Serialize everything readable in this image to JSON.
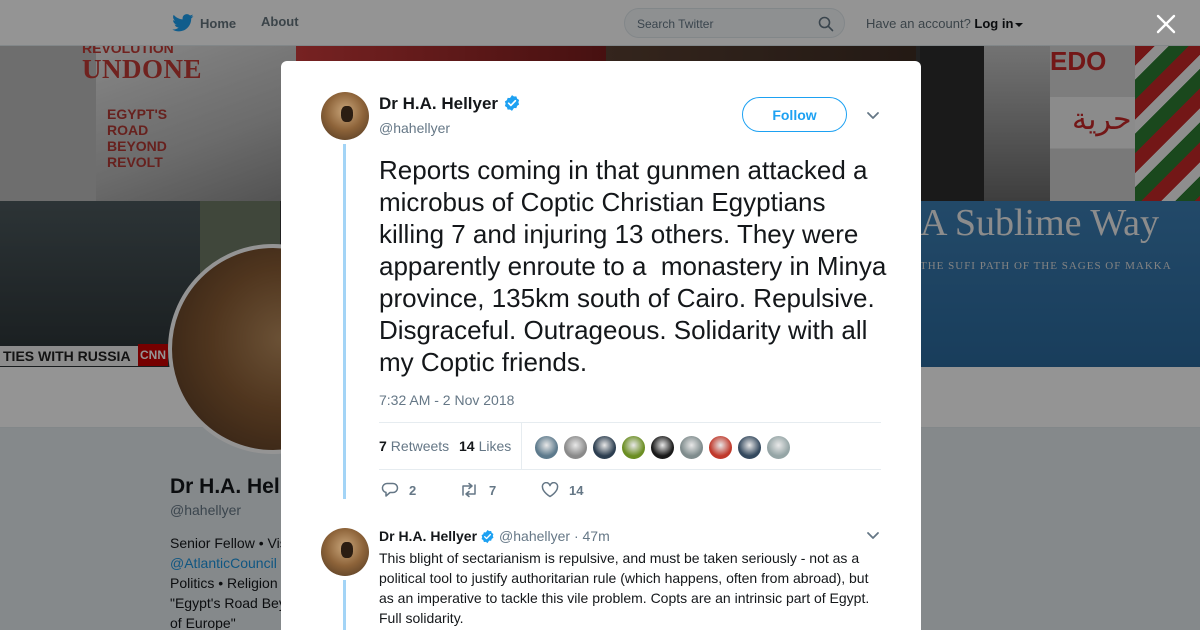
{
  "nav": {
    "home_label": "Home",
    "about_label": "About",
    "search_placeholder": "Search Twitter",
    "account_prompt": "Have an account?",
    "login_label": "Log in"
  },
  "banner": {
    "revolution_text": "REVOLUTION",
    "undone_text": "UNDONE",
    "egypt_road_text": "EGYPT'S ROAD BEYOND REVOLT",
    "cnn_strip_text": "TIES WITH RUSSIA",
    "cnn_logo_text": "CNN",
    "sublime_text": "A Sublime Way",
    "sufi_text": "THE SUFI PATH OF THE SAGES OF MAKKA",
    "arabic_text": "حرية",
    "edo_text": "EDO"
  },
  "profile": {
    "name": "Dr H.A. Hel",
    "handle": "@hahellyer",
    "bio_line1": "Senior Fellow • Vis",
    "bio_link": "@AtlanticCouncil",
    "bio_line3": "Politics • Religion",
    "bio_line4": "\"Egypt's Road Bey",
    "bio_line5": "of Europe\""
  },
  "tweet": {
    "author_name": "Dr H.A. Hellyer",
    "author_handle": "@hahellyer",
    "follow_label": "Follow",
    "text": "Reports coming in that gunmen attacked a microbus of Coptic Christian Egyptians killing 7 and injuring 13 others. They were apparently enroute to a  monastery in Minya province, 135km south of Cairo. Repulsive. Disgraceful. Outrageous. Solidarity with all my Coptic friends.",
    "timestamp": "7:32 AM - 2 Nov 2018",
    "retweets_count": "7",
    "retweets_label": "Retweets",
    "likes_count": "14",
    "likes_label": "Likes",
    "reply_count": "2",
    "retweet_action_count": "7",
    "like_action_count": "14",
    "liker_colors": [
      "#5d7a8c",
      "#8a8a8a",
      "#2c3e50",
      "#6b8e23",
      "#1a1a1a",
      "#7f8c8d",
      "#c0392b",
      "#34495e",
      "#95a5a6"
    ]
  },
  "reply": {
    "author_name": "Dr H.A. Hellyer",
    "author_handle": "@hahellyer",
    "age": "· 47m",
    "text": "This blight of sectarianism is repulsive, and must be taken seriously - not as a political tool to justify authoritarian rule (which happens, often from abroad), but as an imperative to tackle this vile problem. Copts are an intrinsic part of Egypt. Full solidarity."
  },
  "colors": {
    "brand": "#1da1f2",
    "thread_line": "#a3d4f6",
    "muted_text": "#657786"
  }
}
